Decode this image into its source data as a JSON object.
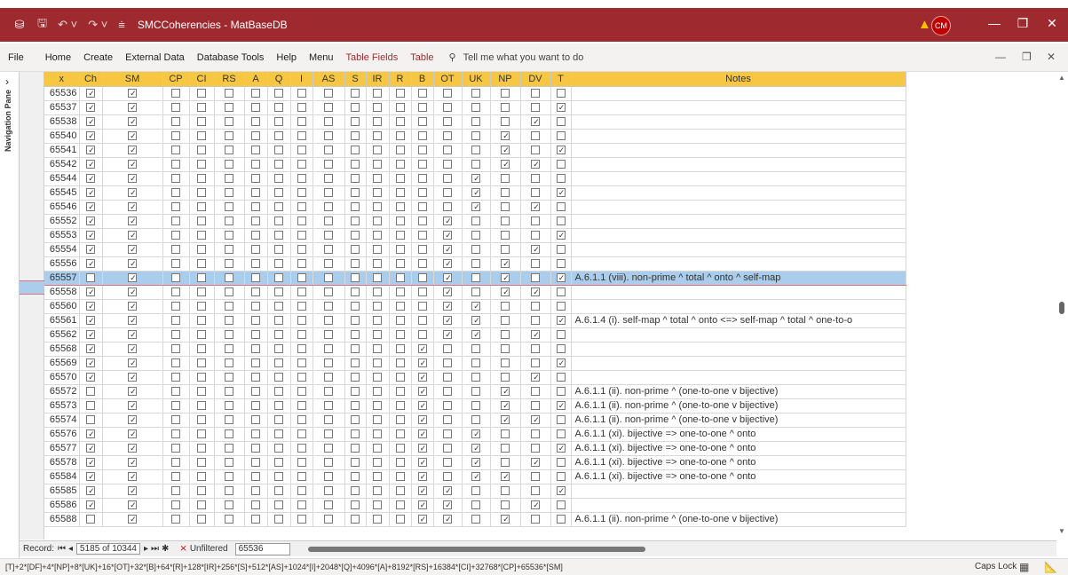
{
  "titlebar": {
    "app_icon": "database-icon",
    "quick_access": [
      "save-icon",
      "undo-icon",
      "redo-icon",
      "customize-icon"
    ],
    "title": "SMCCoherencies - MatBaseDB",
    "avatar_initials": "CM",
    "warning_icon": "warning-icon",
    "window_controls": [
      "minimize-icon",
      "restore-icon",
      "close-icon"
    ]
  },
  "menubar": {
    "items": [
      "File",
      "Home",
      "Create",
      "External Data",
      "Database Tools",
      "Help",
      "Menu"
    ],
    "context_items": [
      "Table Fields",
      "Table"
    ],
    "tell_me": "Tell me what you want to do"
  },
  "navpane": {
    "label": "Navigation Pane"
  },
  "table": {
    "columns": [
      "x",
      "Ch",
      "SM",
      "CP",
      "CI",
      "RS",
      "A",
      "Q",
      "I",
      "AS",
      "S",
      "IR",
      "R",
      "B",
      "OT",
      "UK",
      "NP",
      "DV",
      "T",
      "Notes"
    ],
    "rows": [
      {
        "x": "65536",
        "c": [
          1,
          1,
          0,
          0,
          0,
          0,
          0,
          0,
          0,
          0,
          0,
          0,
          0,
          0,
          0,
          0,
          0,
          0
        ],
        "note": ""
      },
      {
        "x": "65537",
        "c": [
          1,
          1,
          0,
          0,
          0,
          0,
          0,
          0,
          0,
          0,
          0,
          0,
          0,
          0,
          0,
          0,
          0,
          1
        ],
        "note": ""
      },
      {
        "x": "65538",
        "c": [
          1,
          1,
          0,
          0,
          0,
          0,
          0,
          0,
          0,
          0,
          0,
          0,
          0,
          0,
          0,
          0,
          1,
          0
        ],
        "note": ""
      },
      {
        "x": "65540",
        "c": [
          1,
          1,
          0,
          0,
          0,
          0,
          0,
          0,
          0,
          0,
          0,
          0,
          0,
          0,
          0,
          1,
          0,
          0
        ],
        "note": ""
      },
      {
        "x": "65541",
        "c": [
          1,
          1,
          0,
          0,
          0,
          0,
          0,
          0,
          0,
          0,
          0,
          0,
          0,
          0,
          0,
          1,
          0,
          1
        ],
        "note": ""
      },
      {
        "x": "65542",
        "c": [
          1,
          1,
          0,
          0,
          0,
          0,
          0,
          0,
          0,
          0,
          0,
          0,
          0,
          0,
          0,
          1,
          1,
          0
        ],
        "note": ""
      },
      {
        "x": "65544",
        "c": [
          1,
          1,
          0,
          0,
          0,
          0,
          0,
          0,
          0,
          0,
          0,
          0,
          0,
          0,
          1,
          0,
          0,
          0
        ],
        "note": ""
      },
      {
        "x": "65545",
        "c": [
          1,
          1,
          0,
          0,
          0,
          0,
          0,
          0,
          0,
          0,
          0,
          0,
          0,
          0,
          1,
          0,
          0,
          1
        ],
        "note": ""
      },
      {
        "x": "65546",
        "c": [
          1,
          1,
          0,
          0,
          0,
          0,
          0,
          0,
          0,
          0,
          0,
          0,
          0,
          0,
          1,
          0,
          1,
          0
        ],
        "note": ""
      },
      {
        "x": "65552",
        "c": [
          1,
          1,
          0,
          0,
          0,
          0,
          0,
          0,
          0,
          0,
          0,
          0,
          0,
          1,
          0,
          0,
          0,
          0
        ],
        "note": ""
      },
      {
        "x": "65553",
        "c": [
          1,
          1,
          0,
          0,
          0,
          0,
          0,
          0,
          0,
          0,
          0,
          0,
          0,
          1,
          0,
          0,
          0,
          1
        ],
        "note": ""
      },
      {
        "x": "65554",
        "c": [
          1,
          1,
          0,
          0,
          0,
          0,
          0,
          0,
          0,
          0,
          0,
          0,
          0,
          1,
          0,
          0,
          1,
          0
        ],
        "note": ""
      },
      {
        "x": "65556",
        "c": [
          1,
          1,
          0,
          0,
          0,
          0,
          0,
          0,
          0,
          0,
          0,
          0,
          0,
          1,
          0,
          1,
          0,
          0
        ],
        "note": ""
      },
      {
        "x": "65557",
        "c": [
          0,
          1,
          0,
          0,
          0,
          0,
          0,
          0,
          0,
          0,
          0,
          0,
          0,
          1,
          0,
          1,
          0,
          1
        ],
        "note": "A.6.1.1 (viii). non-prime ^ total ^ onto ^ self-map",
        "selected": true
      },
      {
        "x": "65558",
        "c": [
          1,
          1,
          0,
          0,
          0,
          0,
          0,
          0,
          0,
          0,
          0,
          0,
          0,
          1,
          0,
          1,
          1,
          0
        ],
        "note": ""
      },
      {
        "x": "65560",
        "c": [
          1,
          1,
          0,
          0,
          0,
          0,
          0,
          0,
          0,
          0,
          0,
          0,
          0,
          1,
          1,
          0,
          0,
          0
        ],
        "note": ""
      },
      {
        "x": "65561",
        "c": [
          1,
          1,
          0,
          0,
          0,
          0,
          0,
          0,
          0,
          0,
          0,
          0,
          0,
          1,
          1,
          0,
          0,
          1
        ],
        "note": "A.6.1.4 (i). self-map ^ total ^ onto <=> self-map ^ total ^ one-to-o"
      },
      {
        "x": "65562",
        "c": [
          1,
          1,
          0,
          0,
          0,
          0,
          0,
          0,
          0,
          0,
          0,
          0,
          0,
          1,
          1,
          0,
          1,
          0
        ],
        "note": ""
      },
      {
        "x": "65568",
        "c": [
          1,
          1,
          0,
          0,
          0,
          0,
          0,
          0,
          0,
          0,
          0,
          0,
          1,
          0,
          0,
          0,
          0,
          0
        ],
        "note": ""
      },
      {
        "x": "65569",
        "c": [
          1,
          1,
          0,
          0,
          0,
          0,
          0,
          0,
          0,
          0,
          0,
          0,
          1,
          0,
          0,
          0,
          0,
          1
        ],
        "note": ""
      },
      {
        "x": "65570",
        "c": [
          1,
          1,
          0,
          0,
          0,
          0,
          0,
          0,
          0,
          0,
          0,
          0,
          1,
          0,
          0,
          0,
          1,
          0
        ],
        "note": ""
      },
      {
        "x": "65572",
        "c": [
          0,
          1,
          0,
          0,
          0,
          0,
          0,
          0,
          0,
          0,
          0,
          0,
          1,
          0,
          0,
          1,
          0,
          0
        ],
        "note": "A.6.1.1 (ii). non-prime ^ (one-to-one v bijective)"
      },
      {
        "x": "65573",
        "c": [
          0,
          1,
          0,
          0,
          0,
          0,
          0,
          0,
          0,
          0,
          0,
          0,
          1,
          0,
          0,
          1,
          0,
          1
        ],
        "note": "A.6.1.1 (ii). non-prime ^ (one-to-one v bijective)"
      },
      {
        "x": "65574",
        "c": [
          0,
          1,
          0,
          0,
          0,
          0,
          0,
          0,
          0,
          0,
          0,
          0,
          1,
          0,
          0,
          1,
          1,
          0
        ],
        "note": "A.6.1.1 (ii). non-prime ^ (one-to-one v bijective)"
      },
      {
        "x": "65576",
        "c": [
          1,
          1,
          0,
          0,
          0,
          0,
          0,
          0,
          0,
          0,
          0,
          0,
          1,
          0,
          1,
          0,
          0,
          0
        ],
        "note": "A.6.1.1 (xi). bijective => one-to-one ^  onto"
      },
      {
        "x": "65577",
        "c": [
          1,
          1,
          0,
          0,
          0,
          0,
          0,
          0,
          0,
          0,
          0,
          0,
          1,
          0,
          1,
          0,
          0,
          1
        ],
        "note": "A.6.1.1 (xi). bijective => one-to-one ^  onto"
      },
      {
        "x": "65578",
        "c": [
          1,
          1,
          0,
          0,
          0,
          0,
          0,
          0,
          0,
          0,
          0,
          0,
          1,
          0,
          1,
          0,
          1,
          0
        ],
        "note": "A.6.1.1 (xi). bijective => one-to-one ^  onto"
      },
      {
        "x": "65584",
        "c": [
          1,
          1,
          0,
          0,
          0,
          0,
          0,
          0,
          0,
          0,
          0,
          0,
          1,
          0,
          1,
          1,
          0,
          0
        ],
        "note": "A.6.1.1 (xi). bijective => one-to-one ^  onto"
      },
      {
        "x": "65585",
        "c": [
          1,
          1,
          0,
          0,
          0,
          0,
          0,
          0,
          0,
          0,
          0,
          0,
          1,
          1,
          0,
          0,
          0,
          1
        ],
        "note": ""
      },
      {
        "x": "65586",
        "c": [
          1,
          1,
          0,
          0,
          0,
          0,
          0,
          0,
          0,
          0,
          0,
          0,
          1,
          1,
          0,
          0,
          1,
          0
        ],
        "note": ""
      },
      {
        "x": "65588",
        "c": [
          0,
          1,
          0,
          0,
          0,
          0,
          0,
          0,
          0,
          0,
          0,
          0,
          1,
          1,
          0,
          1,
          0,
          0
        ],
        "note": "A.6.1.1 (ii). non-prime ^ (one-to-one v bijective)"
      }
    ]
  },
  "recordbar": {
    "label": "Record:",
    "position": "5185 of 10344",
    "filter": "Unfiltered",
    "search": "65536"
  },
  "status": {
    "expression": "[T]+2*[DF]+4*[NP]+8*[UK]+16*[OT]+32*[B]+64*[R]+128*[IR]+256*[S]+512*[AS]+1024*[I]+2048*[Q]+4096*[A]+8192*[RS]+16384*[CI]+32768*[CP]+65536*[SM]",
    "caps": "Caps Lock"
  }
}
